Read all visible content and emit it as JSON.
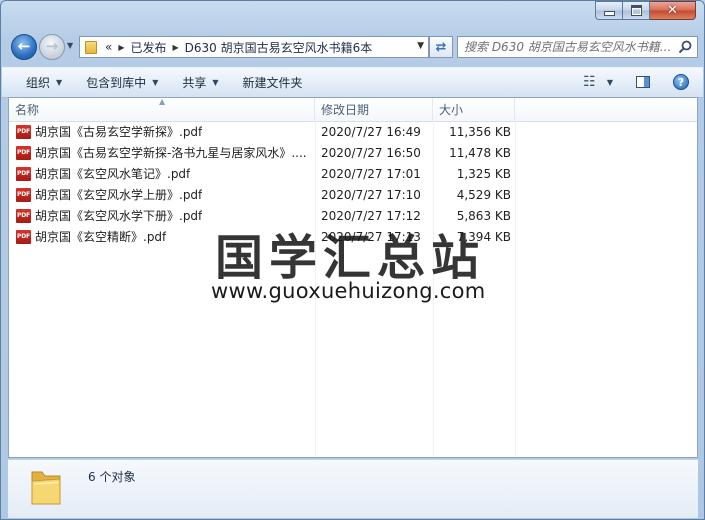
{
  "window": {
    "caption_buttons": {
      "minimize_icon": "minimize-icon",
      "maximize_icon": "maximize-icon",
      "close_icon": "close-icon"
    }
  },
  "nav": {
    "breadcrumb_prefix": "«",
    "breadcrumb": [
      "已发布",
      "D630 胡京国古易玄空风水书籍6本"
    ],
    "search_placeholder": "搜索 D630 胡京国古易玄空风水书籍..."
  },
  "toolbar": {
    "organize": "组织",
    "include_library": "包含到库中",
    "share": "共享",
    "new_folder": "新建文件夹",
    "help": "?"
  },
  "columns": {
    "name": "名称",
    "date": "修改日期",
    "size": "大小"
  },
  "files": [
    {
      "name": "胡京国《古易玄空学新探》.pdf",
      "date": "2020/7/27 16:49",
      "size": "11,356 KB"
    },
    {
      "name": "胡京国《古易玄空学新探-洛书九星与居家风水》....",
      "date": "2020/7/27 16:50",
      "size": "11,478 KB"
    },
    {
      "name": "胡京国《玄空风水笔记》.pdf",
      "date": "2020/7/27 17:01",
      "size": "1,325 KB"
    },
    {
      "name": "胡京国《玄空风水学上册》.pdf",
      "date": "2020/7/27 17:10",
      "size": "4,529 KB"
    },
    {
      "name": "胡京国《玄空风水学下册》.pdf",
      "date": "2020/7/27 17:12",
      "size": "5,863 KB"
    },
    {
      "name": "胡京国《玄空精断》.pdf",
      "date": "2020/7/27 17:13",
      "size": "7,394 KB"
    }
  ],
  "file_icon_label": "PDF",
  "watermark": {
    "title": "国学汇总站",
    "url": "www.guoxuehuizong.com"
  },
  "status": {
    "count_text": "6 个对象"
  },
  "colors": {
    "accent": "#3973c0",
    "pdf_icon": "#c8261f",
    "window_frame": "#b4cce6"
  }
}
